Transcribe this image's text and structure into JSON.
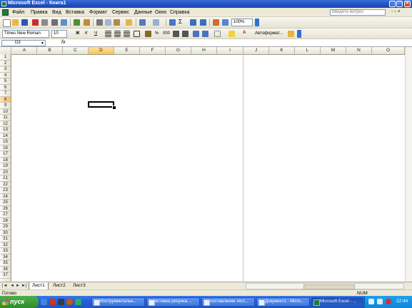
{
  "window": {
    "title": "Microsoft Excel - Книга1",
    "min_label": "_",
    "max_label": "□",
    "close_label": "×"
  },
  "menu": {
    "items": [
      "Файл",
      "Правка",
      "Вид",
      "Вставка",
      "Формат",
      "Сервис",
      "Данные",
      "Окно",
      "Справка"
    ],
    "help_placeholder": "Введите вопрос",
    "doc_close": "- ▫ ×"
  },
  "toolbar": {
    "zoom": "100%",
    "font": "Times New Roman",
    "size": "10",
    "autoformat": "Автоформат..."
  },
  "formula_bar": {
    "name_box": "D3",
    "fx": "fx",
    "value": ""
  },
  "grid": {
    "columns": [
      "A",
      "B",
      "C",
      "D",
      "E",
      "F",
      "G",
      "H",
      "I",
      "J",
      "K",
      "L",
      "M",
      "N",
      "O"
    ],
    "rows": [
      "1",
      "2",
      "3",
      "4",
      "5",
      "6",
      "7",
      "8",
      "9",
      "10",
      "11",
      "12",
      "13",
      "14",
      "15",
      "16",
      "17",
      "18",
      "19",
      "20",
      "21",
      "22",
      "23",
      "24",
      "25",
      "26",
      "27",
      "28",
      "29",
      "30",
      "31",
      "32",
      "33",
      "34",
      "35",
      "36",
      "37"
    ],
    "active_column": "D",
    "active_row": "8"
  },
  "sheets": {
    "tabs": [
      "Лист1",
      "Лист2",
      "Лист3"
    ],
    "active": "Лист1"
  },
  "status": {
    "text": "Готово",
    "num": "NUM"
  },
  "taskbar": {
    "start": "пуск",
    "items": [
      {
        "label": "Инструментальн...",
        "active": false
      },
      {
        "label": "вставка рисунка ...",
        "active": false
      },
      {
        "label": "составление тест...",
        "active": false
      },
      {
        "label": "Документ1 - Micro...",
        "active": false
      },
      {
        "label": "Microsoft Excel - ...",
        "active": true
      }
    ],
    "clock": "22:44"
  },
  "colors": {
    "title_bar": "#2150c0",
    "active_header": "#fbc04f",
    "taskbar": "#245edb",
    "start": "#2f8c2a"
  }
}
